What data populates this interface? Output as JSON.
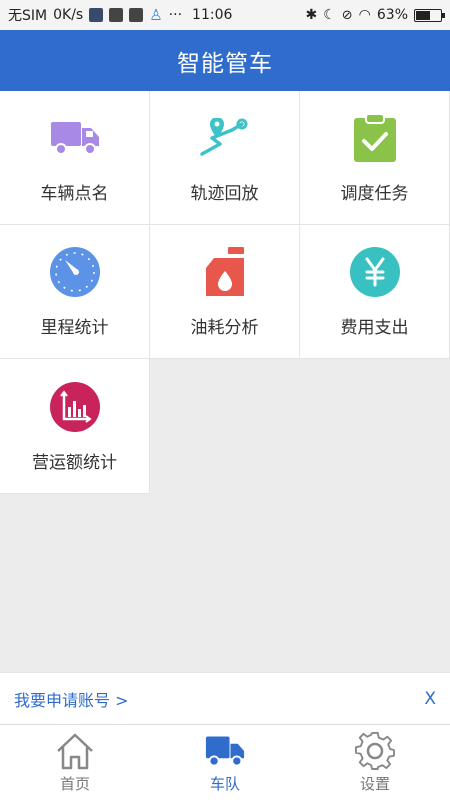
{
  "status_bar": {
    "carrier": "无SIM",
    "speed": "0K/s",
    "dots": "···",
    "time": "11:06",
    "battery": "63%",
    "battery_level": 0.63
  },
  "header": {
    "title": "智能管车"
  },
  "menu": [
    {
      "label": "车辆点名",
      "icon": "truck-icon",
      "color": "#a88ae6"
    },
    {
      "label": "轨迹回放",
      "icon": "route-icon",
      "color": "#3cc3c9"
    },
    {
      "label": "调度任务",
      "icon": "clipboard-check-icon",
      "color": "#8bc34a"
    },
    {
      "label": "里程统计",
      "icon": "compass-icon",
      "color": "#5c93e6"
    },
    {
      "label": "油耗分析",
      "icon": "fuel-can-icon",
      "color": "#e8574c"
    },
    {
      "label": "费用支出",
      "icon": "yen-icon",
      "color": "#39c1c1"
    },
    {
      "label": "营运额统计",
      "icon": "chart-icon",
      "color": "#c8245b"
    }
  ],
  "apply_bar": {
    "link": "我要申请账号 >",
    "close": "X"
  },
  "tabs": [
    {
      "label": "首页",
      "icon": "home-icon",
      "active": false
    },
    {
      "label": "车队",
      "icon": "truck-icon",
      "active": true
    },
    {
      "label": "设置",
      "icon": "gear-icon",
      "active": false
    }
  ],
  "colors": {
    "primary": "#2f6ccc",
    "background": "#ececec"
  }
}
